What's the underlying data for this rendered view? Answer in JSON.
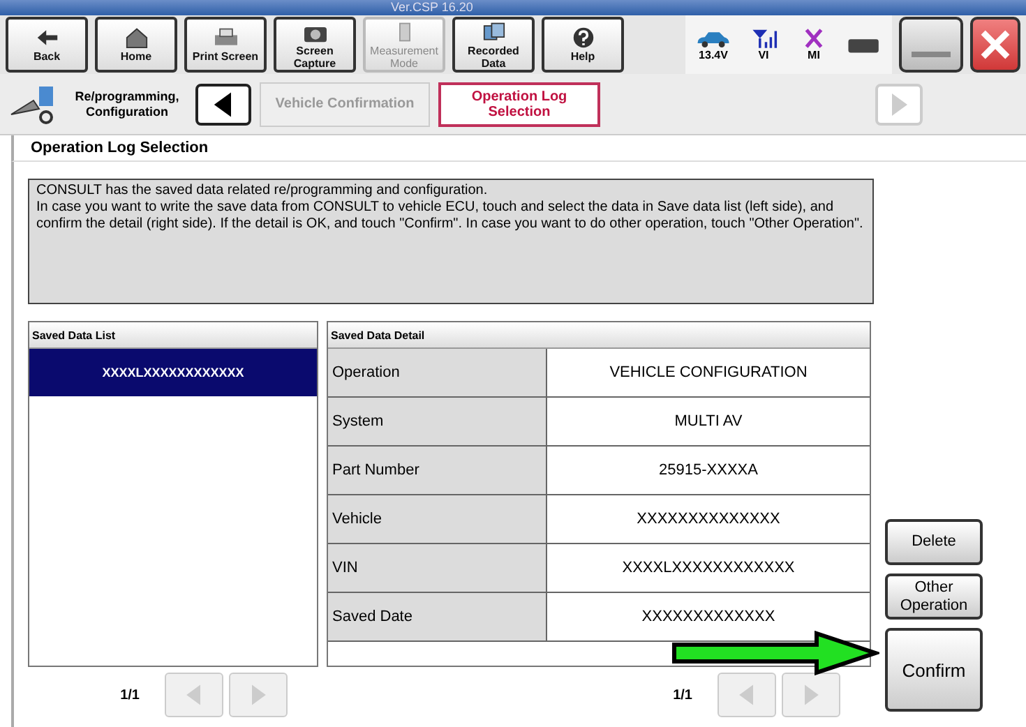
{
  "version": "Ver.CSP 16.20",
  "toolbar": {
    "buttons": [
      {
        "label": "Back",
        "disabled": false
      },
      {
        "label": "Home",
        "disabled": false
      },
      {
        "label": "Print Screen",
        "disabled": false
      },
      {
        "label": "Screen Capture",
        "disabled": false
      },
      {
        "label": "Measurement Mode",
        "disabled": true
      },
      {
        "label": "Recorded Data",
        "disabled": false
      },
      {
        "label": "Help",
        "disabled": false
      }
    ],
    "status": {
      "voltage": "13.4V",
      "vi": "VI",
      "mi": "MI"
    }
  },
  "breadcrumb": {
    "mode": "Re/programming, Configuration",
    "steps": [
      {
        "label": "Vehicle Confirmation",
        "selected": false
      },
      {
        "label": "Operation Log Selection",
        "selected": true
      }
    ]
  },
  "section_title": "Operation Log Selection",
  "message": [
    "CONSULT has the saved data related re/programming and configuration.",
    "In case you want to write the save data from CONSULT to vehicle ECU, touch and select the data in Save data list (left side), and confirm the detail (right side). If the detail is OK, and touch \"Confirm\".  In case you want to do other operation, touch \"Other Operation\"."
  ],
  "saved_data_list": {
    "header": "Saved Data List",
    "items": [
      {
        "label": "XXXXLXXXXXXXXXXXX",
        "selected": true
      }
    ],
    "pager": "1/1"
  },
  "saved_data_detail": {
    "header": "Saved Data Detail",
    "rows": [
      {
        "label": "Operation",
        "value": "VEHICLE CONFIGURATION"
      },
      {
        "label": "System",
        "value": "MULTI AV"
      },
      {
        "label": "Part Number",
        "value": "25915-XXXXA"
      },
      {
        "label": "Vehicle",
        "value": "XXXXXXXXXXXXXX"
      },
      {
        "label": "VIN",
        "value": "XXXXLXXXXXXXXXXXX"
      },
      {
        "label": "Saved Date",
        "value": "XXXXXXXXXXXXX"
      }
    ],
    "pager": "1/1"
  },
  "actions": [
    "Delete",
    "Other Operation",
    "Confirm"
  ]
}
